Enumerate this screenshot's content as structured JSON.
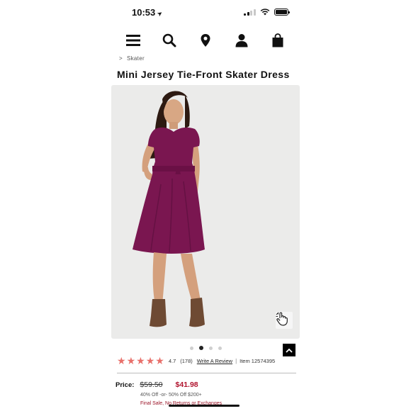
{
  "status_bar": {
    "time": "10:53",
    "location_icon": "location-arrow-icon",
    "signal_icon": "cellular-signal-icon",
    "wifi_icon": "wifi-icon",
    "battery_icon": "battery-icon",
    "battery_level": 1.0
  },
  "nav": {
    "menu_icon": "hamburger-menu-icon",
    "search_icon": "search-icon",
    "store_icon": "location-pin-icon",
    "account_icon": "user-icon",
    "bag_icon": "shopping-bag-icon"
  },
  "breadcrumb": {
    "separator": ">",
    "current": "Skater"
  },
  "product": {
    "title": "Mini Jersey Tie-Front Skater Dress",
    "image_description_icon": "model-photo",
    "dress_color": "#7a1650",
    "zoom_icon": "hand-pointer-icon",
    "carousel": {
      "count": 4,
      "active_index": 1
    },
    "scroll_top_icon": "chevron-up-icon"
  },
  "rating": {
    "stars": 5,
    "star_color": "#e8706b",
    "value": "4.7",
    "count": "(178)",
    "write_review": "Write A Review",
    "separator": "|",
    "item_number": "Item 12574395"
  },
  "price": {
    "label": "Price:",
    "original": "$59.50",
    "sale": "$41.98",
    "sale_color": "#b0122d",
    "promo": "40% Off -or- 50% Off $200+",
    "final_sale": "Final Sale, No Returns or Exchanges"
  }
}
